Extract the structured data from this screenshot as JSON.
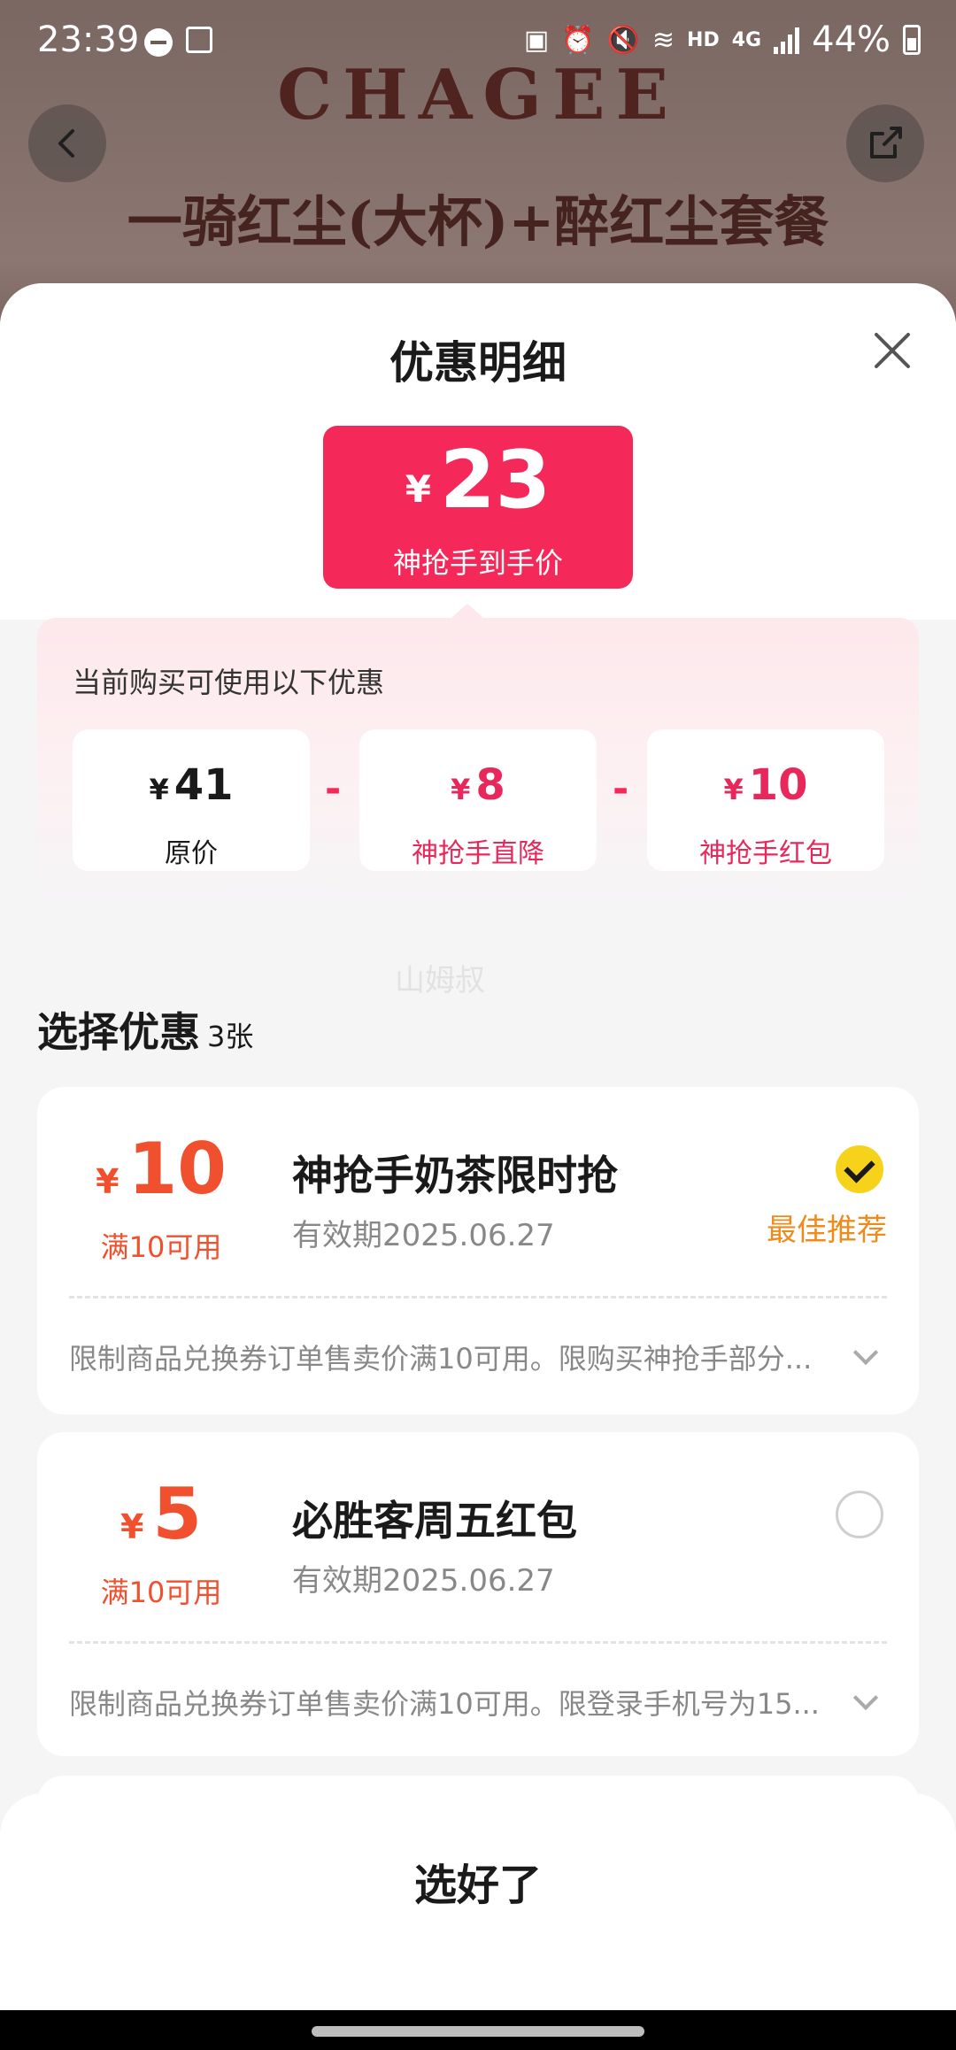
{
  "status_bar": {
    "time": "23:39",
    "battery": "44%",
    "network_hd": "HD",
    "network_gen": "4G"
  },
  "background": {
    "brand": "CHAGEE",
    "product_title": "一骑红尘(大杯)+醉红尘套餐"
  },
  "sheet": {
    "title": "优惠明细",
    "final_price": {
      "currency": "¥",
      "value": "23",
      "label": "神抢手到手价"
    },
    "breakdown": {
      "caption": "当前购买可使用以下优惠",
      "operator": "-",
      "items": [
        {
          "currency": "¥",
          "value": "41",
          "label": "原价",
          "color": "#1a1a1a"
        },
        {
          "currency": "¥",
          "value": "8",
          "label": "神抢手直降",
          "color": "#e8285a"
        },
        {
          "currency": "¥",
          "value": "10",
          "label": "神抢手红包",
          "color": "#e8285a"
        }
      ]
    },
    "watermark": "山姆叔",
    "section": {
      "title": "选择优惠",
      "count": "3张"
    },
    "coupons": [
      {
        "currency": "¥",
        "amount": "10",
        "condition": "满10可用",
        "title": "神抢手奶茶限时抢",
        "validity": "有效期2025.06.27",
        "tag": "最佳推荐",
        "selected": true,
        "description": "限制商品兑换券订单售卖价满10可用。限购买神抢手部分..."
      },
      {
        "currency": "¥",
        "amount": "5",
        "condition": "满10可用",
        "title": "必胜客周五红包",
        "validity": "有效期2025.06.27",
        "tag": "",
        "selected": false,
        "description": "限制商品兑换券订单售卖价满10可用。限登录手机号为15..."
      }
    ],
    "confirm_label": "选好了"
  },
  "colors": {
    "accent_pink": "#f5285a",
    "coupon_orange": "#f0502d",
    "recommend_orange": "#f08a1a",
    "check_yellow": "#f7d21b"
  }
}
